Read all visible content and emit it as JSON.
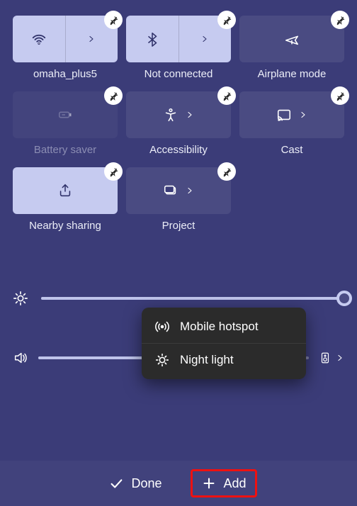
{
  "tiles": [
    {
      "label": "omaha_plus5",
      "icon": "wifi",
      "active": true,
      "split": true,
      "disabled": false
    },
    {
      "label": "Not connected",
      "icon": "bluetooth",
      "active": true,
      "split": true,
      "disabled": false
    },
    {
      "label": "Airplane mode",
      "icon": "airplane",
      "active": false,
      "split": false,
      "disabled": false
    },
    {
      "label": "Battery saver",
      "icon": "battery",
      "active": false,
      "split": false,
      "disabled": true
    },
    {
      "label": "Accessibility",
      "icon": "access",
      "active": false,
      "split": false,
      "disabled": false,
      "chev": true
    },
    {
      "label": "Cast",
      "icon": "cast",
      "active": false,
      "split": false,
      "disabled": false,
      "chev": true
    },
    {
      "label": "Nearby sharing",
      "icon": "share",
      "active": true,
      "split": false,
      "disabled": false
    },
    {
      "label": "Project",
      "icon": "project",
      "active": false,
      "split": false,
      "disabled": false,
      "chev": true
    }
  ],
  "brightness": {
    "percent": 100
  },
  "volume": {
    "percent": 60
  },
  "menu": [
    {
      "label": "Mobile hotspot",
      "icon": "hotspot"
    },
    {
      "label": "Night light",
      "icon": "nightlight"
    }
  ],
  "footer": {
    "done": "Done",
    "add": "Add"
  }
}
